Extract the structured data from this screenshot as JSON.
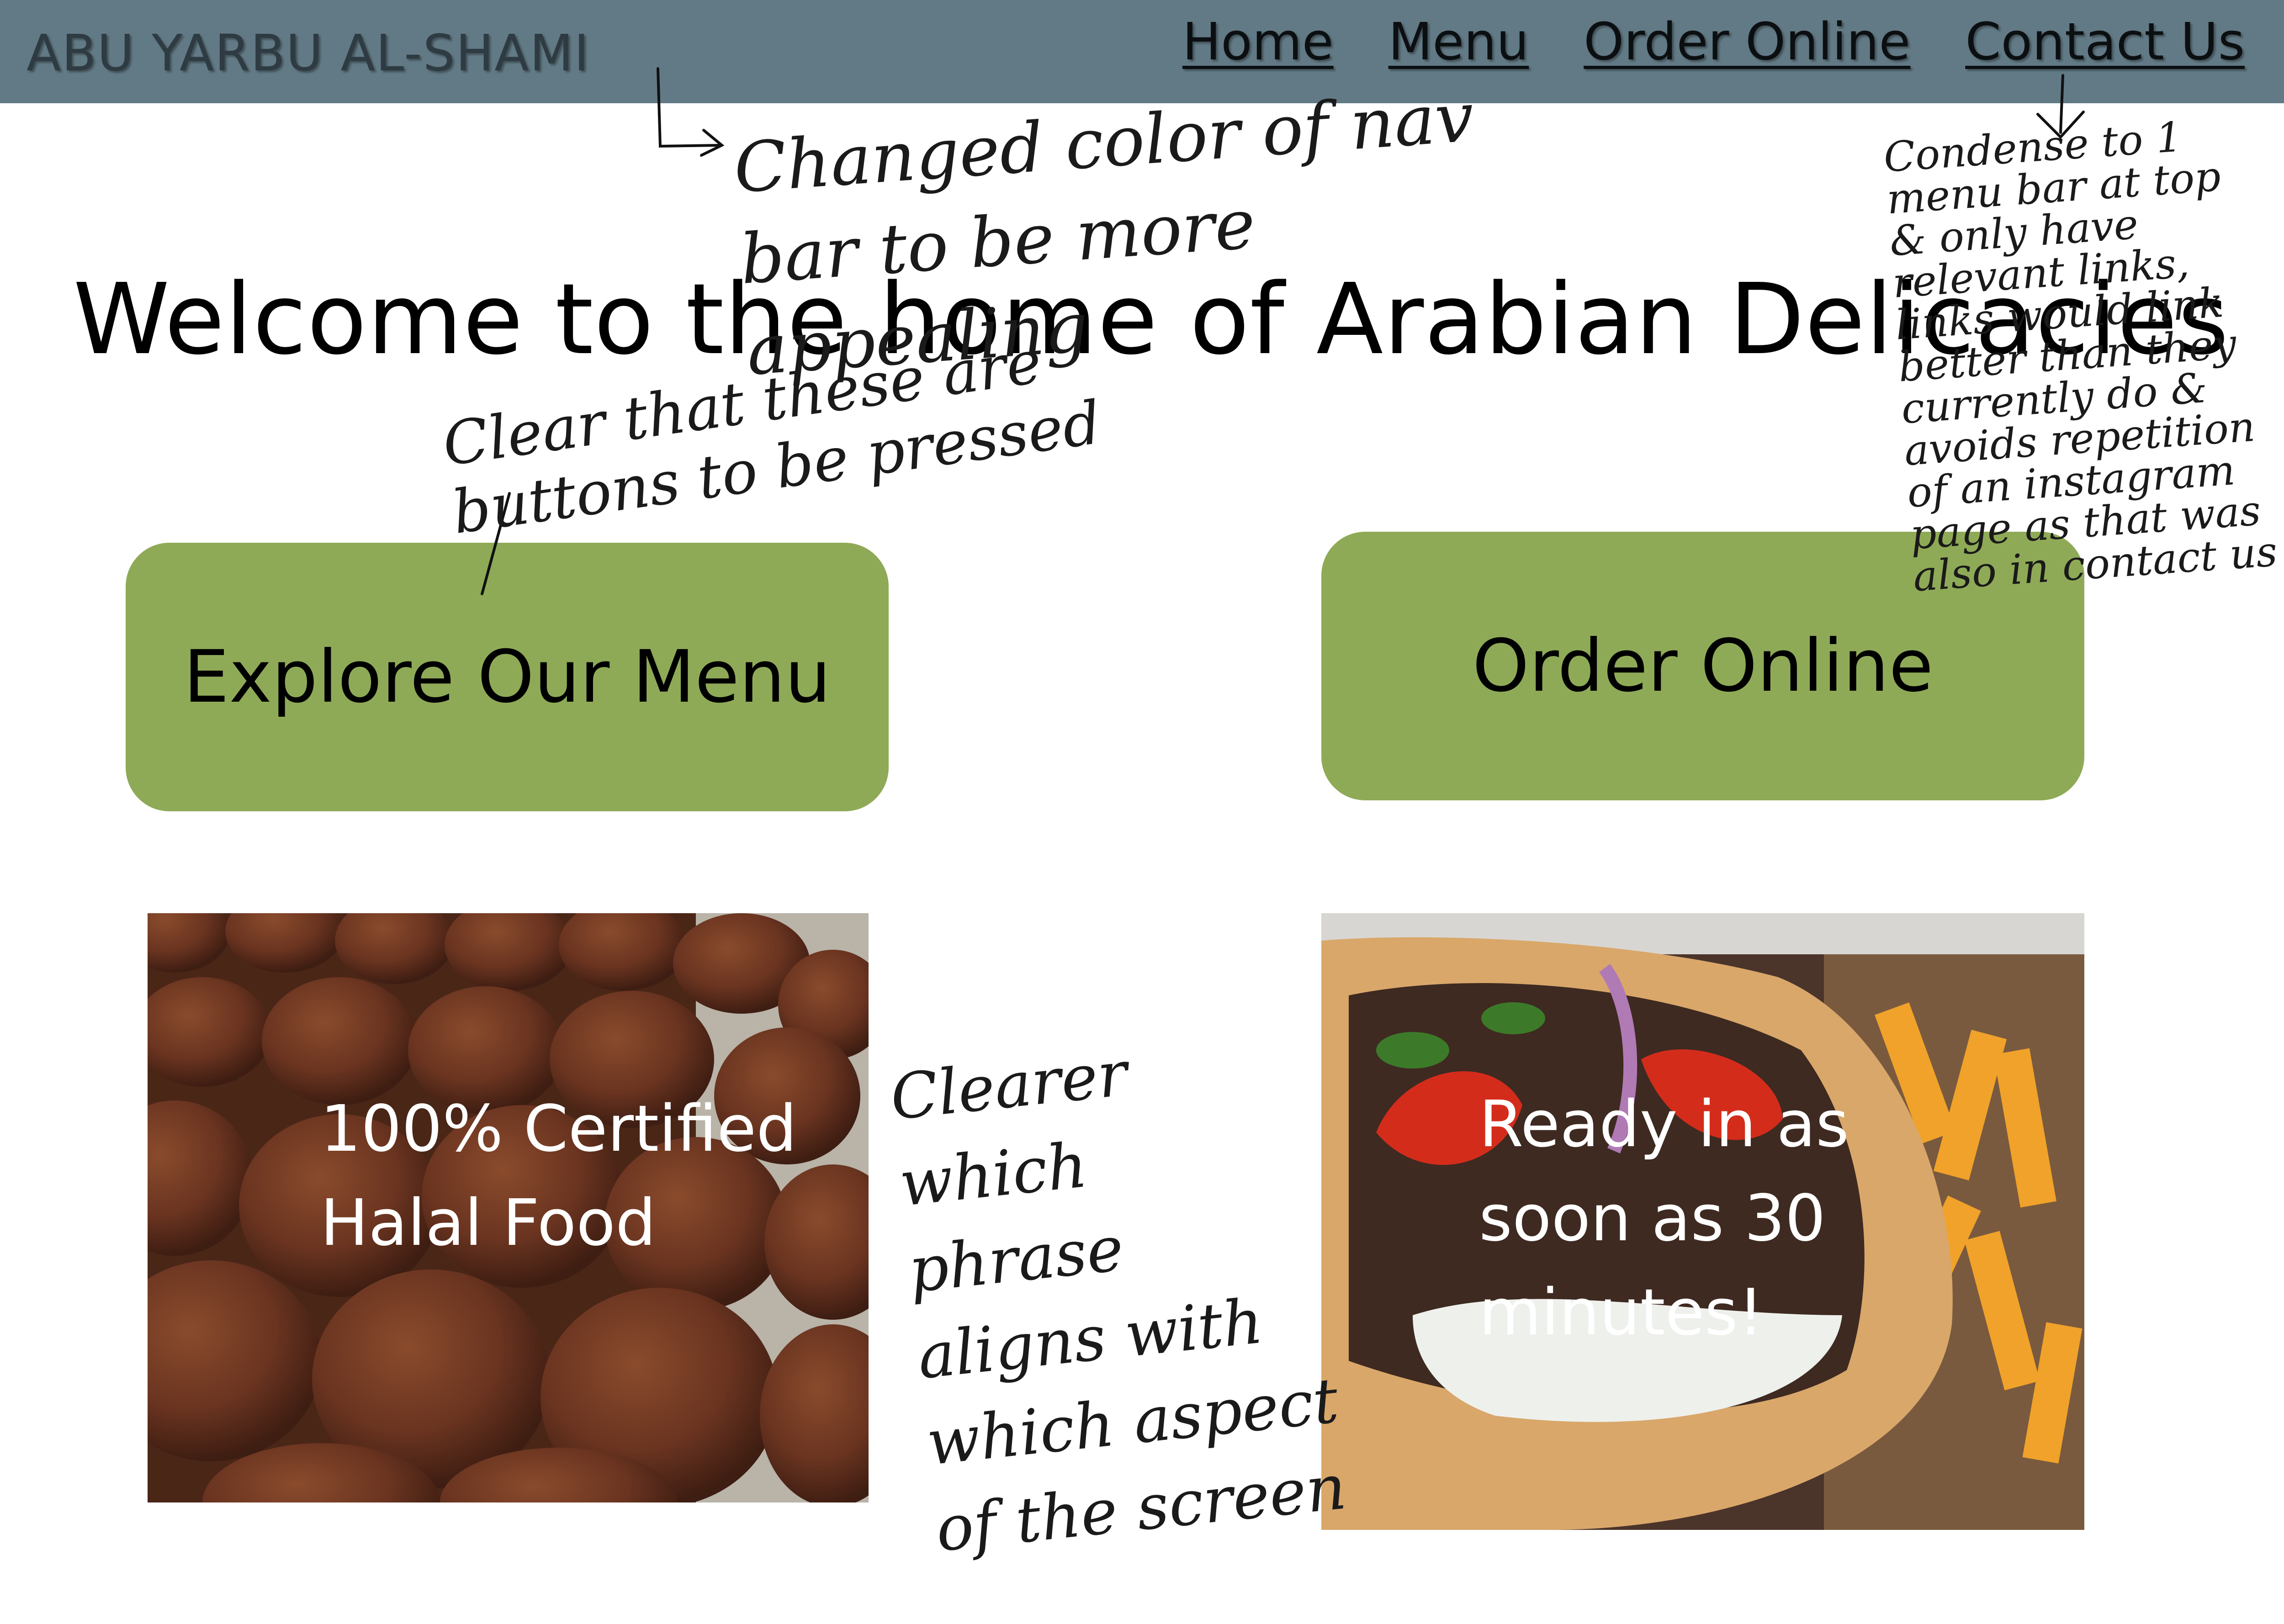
{
  "navbar": {
    "brand": "ABU YARBU AL-SHAMI",
    "links": [
      "Home",
      "Menu",
      "Order Online",
      "Contact Us"
    ]
  },
  "hero": {
    "headline": "Welcome to the home of Arabian Delicacies"
  },
  "buttons": {
    "explore_menu": "Explore Our Menu",
    "order_online": "Order Online"
  },
  "cards": {
    "falafel_caption": "100% Certified Halal Food",
    "shawarma_caption": "Ready in as soon as 30 minutes!"
  },
  "annotations": {
    "nav_color": "Changed color of nav bar to be more appealing",
    "buttons_clear": "Clear that these are buttons to be pressed",
    "condense_menu": "Condense to 1 menu bar at top & only have relevant links, links would link better than they currently do & avoids repetition of an instagram page as that was also in contact us",
    "clearer_phrase": "Clearer which phrase aligns with which aspect of the screen"
  },
  "colors": {
    "navbar": "#627a85",
    "button": "#8faa57",
    "background": "#ffffff"
  }
}
